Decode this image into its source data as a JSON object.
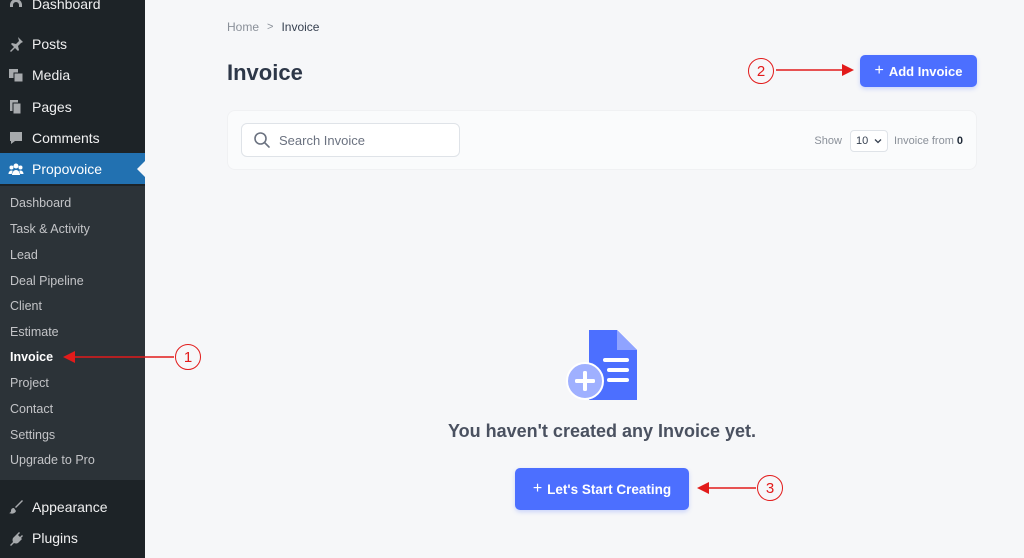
{
  "sidebar": {
    "top_items": [
      {
        "label": "Dashboard",
        "icon": "dashboard-icon"
      },
      {
        "label": "Posts",
        "icon": "pin-icon"
      },
      {
        "label": "Media",
        "icon": "media-icon"
      },
      {
        "label": "Pages",
        "icon": "pages-icon"
      },
      {
        "label": "Comments",
        "icon": "comment-icon"
      },
      {
        "label": "Propovoice",
        "icon": "groups-icon",
        "active": true
      }
    ],
    "submenu": [
      "Dashboard",
      "Task & Activity",
      "Lead",
      "Deal Pipeline",
      "Client",
      "Estimate",
      "Invoice",
      "Project",
      "Contact",
      "Settings",
      "Upgrade to Pro"
    ],
    "current_submenu": "Invoice",
    "bottom_items": [
      {
        "label": "Appearance",
        "icon": "brush-icon"
      },
      {
        "label": "Plugins",
        "icon": "plugin-icon"
      }
    ]
  },
  "breadcrumb": {
    "home": "Home",
    "separator": ">",
    "current": "Invoice"
  },
  "header": {
    "title": "Invoice",
    "add_button": "Add Invoice"
  },
  "filters": {
    "search_placeholder": "Search Invoice",
    "show_label": "Show",
    "per_page": "10",
    "from_label": "Invoice from",
    "total": "0"
  },
  "empty_state": {
    "message": "You haven't created any Invoice yet.",
    "button": "Let's Start Creating"
  },
  "annotations": [
    "1",
    "2",
    "3"
  ],
  "colors": {
    "sidebar_bg": "#1d2327",
    "submenu_bg": "#2c3338",
    "active_menu": "#2271b1",
    "primary": "#4c6fff",
    "annotation": "#e21b1b",
    "page_bg": "#f6f7f9"
  }
}
